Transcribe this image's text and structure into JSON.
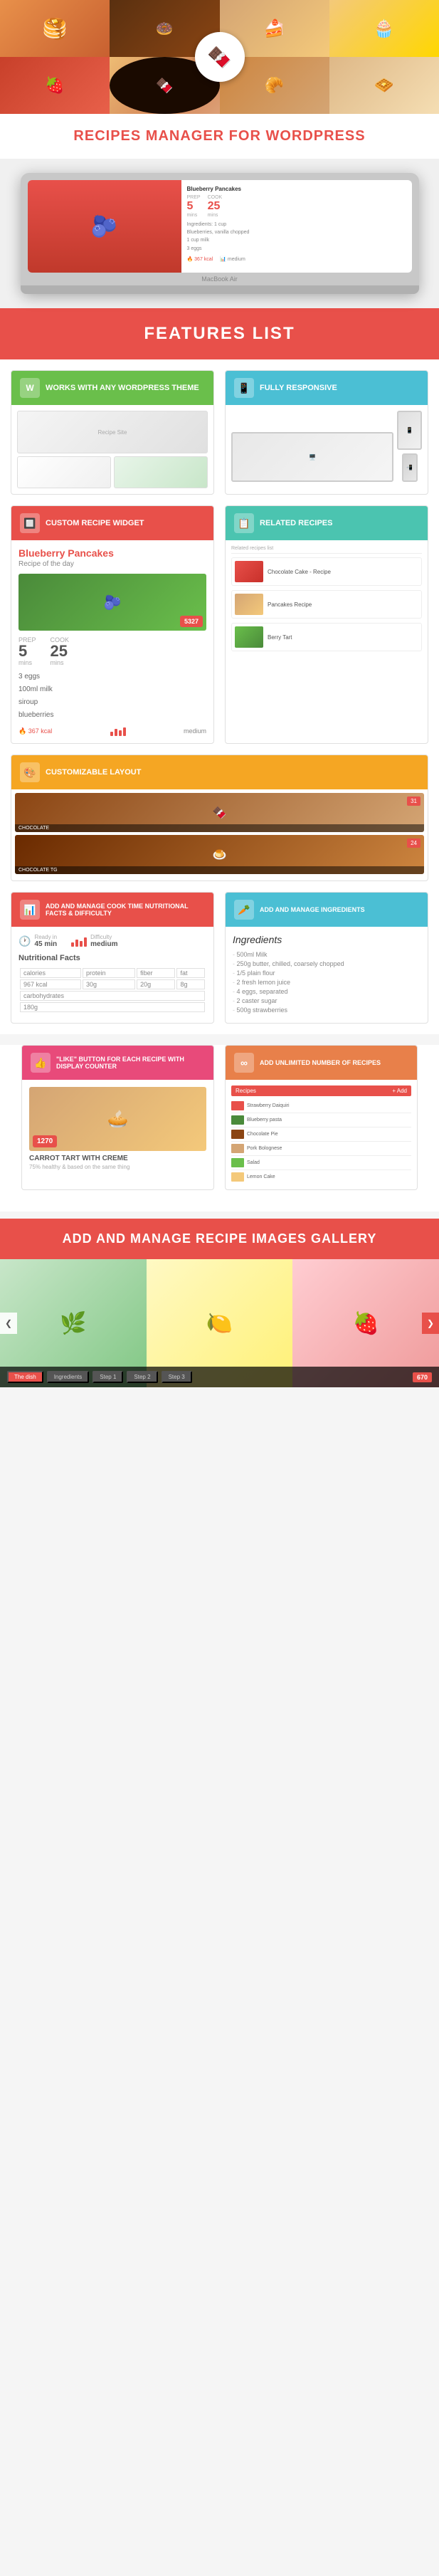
{
  "site_title": "Recipes Manager for WordPress",
  "hero": {
    "logo_icon": "🍫"
  },
  "macbook": {
    "screen_title": "Blueberry Pancakes",
    "prep_label": "PREP",
    "cook_label": "COOK",
    "prep_value": "5",
    "cook_value": "25",
    "mins_label": "mins",
    "brand": "MacBook Air"
  },
  "features_banner": {
    "title": "FEATURES LIST"
  },
  "feature_wordpress": {
    "header": "WORKS WITH ANY WORDPRESS THEME",
    "icon": "W"
  },
  "feature_responsive": {
    "header": "FULLY RESPONSIVE",
    "icon": "📱"
  },
  "feature_widget": {
    "header": "CUSTOM RECIPE WIDGET",
    "icon": "🔲",
    "recipe_name": "Blueberry Pancakes",
    "recipe_subtitle": "Recipe of the day",
    "prep_label": "PREP",
    "cook_label": "COOK",
    "prep_value": "5",
    "cook_value": "25",
    "mins": "mins",
    "badge": "5327",
    "ingredients": [
      "3 eggs",
      "100ml milk",
      "siroup",
      "blueberries"
    ],
    "calories": "367 kcal",
    "difficulty": "medium"
  },
  "feature_related": {
    "header": "RELATED RECIPES",
    "icon": "📋",
    "items": [
      {
        "name": "Chocolate Cake",
        "color": "#8B4513"
      },
      {
        "name": "Pancakes",
        "color": "#D4A574"
      },
      {
        "name": "Berry Tart",
        "color": "#c8402a"
      }
    ]
  },
  "feature_layout": {
    "header": "CUSTOMIZABLE LAYOUT",
    "icon": "🎨",
    "items": [
      {
        "name": "CHOCOLATE",
        "badge": "31"
      },
      {
        "name": "CHOCOLATE TG",
        "badge": "24"
      }
    ]
  },
  "feature_nutritional": {
    "header": "ADD AND MANAGE COOK TIME NUTRITIONAL FACTS & DIFFICULTY",
    "icon": "📊",
    "ready_label": "Ready in",
    "ready_value": "45 min",
    "difficulty_label": "Difficulty",
    "difficulty_value": "medium",
    "facts_title": "Nutritional Facts",
    "facts": {
      "calories": {
        "label": "calories",
        "value": "967 kcal"
      },
      "protein": {
        "label": "protein",
        "value": "30g"
      },
      "fiber": {
        "label": "fiber",
        "value": "20g"
      },
      "fat": {
        "label": "fat",
        "value": "8g"
      },
      "carbohydrates": {
        "label": "carbohydrates",
        "value": "180g"
      }
    }
  },
  "feature_ingredients": {
    "header": "ADD AND MANAGE INGREDIENTS",
    "icon": "🥕",
    "title": "Ingredients",
    "items": [
      "500ml Milk",
      "250g butter, chilled, coarsely chopped",
      "1/5 plain flour",
      "2 fresh lemon juice",
      "4 eggs, separated",
      "2 caster sugar",
      "500g strawberries"
    ]
  },
  "feature_like": {
    "header": "\"LIKE\" BUTTON FOR EACH RECIPE WITH DISPLAY COUNTER",
    "icon": "👍",
    "tart_title": "CARROT TART WITH CREME",
    "tart_subtitle": "75% healthy & based on the same thing",
    "tart_count": "1270"
  },
  "feature_unlimited": {
    "header": "ADD UNLIMITED NUMBER OF RECIPES",
    "icon": "∞",
    "table_header": "Recipes",
    "recipes": [
      {
        "name": "Strawberry Daiquiri",
        "color": "#e8504a"
      },
      {
        "name": "Blueberry pasta",
        "color": "#4a8a3a"
      },
      {
        "name": "Chocolate Pie",
        "color": "#8B4513"
      },
      {
        "name": "Pork Bolognese",
        "color": "#D4A574"
      },
      {
        "name": "Salad",
        "color": "#6abf4b"
      },
      {
        "name": "Lemon Cake",
        "color": "#F4C97A"
      }
    ]
  },
  "gallery": {
    "header": "ADD AND MANAGE RECIPE IMAGES GALLERY",
    "tabs": [
      "The dish",
      "Ingredients",
      "Step 1",
      "Step 2",
      "Step 3"
    ],
    "count": "670",
    "nav_left": "❮",
    "nav_right": "❯"
  }
}
